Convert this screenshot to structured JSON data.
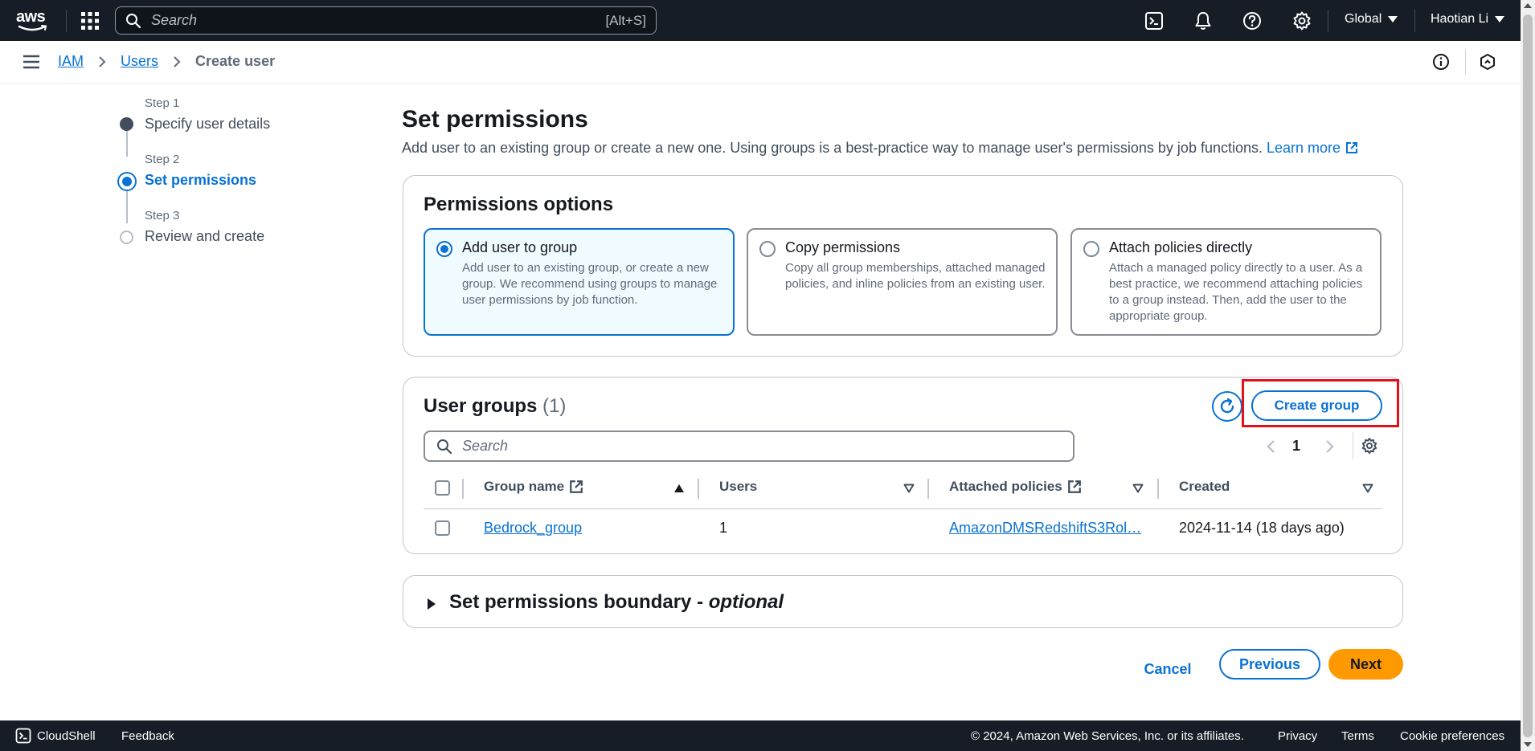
{
  "topbar": {
    "logo_text": "aws",
    "search_placeholder": "Search",
    "search_shortcut": "[Alt+S]",
    "region": "Global",
    "user": "Haotian Li"
  },
  "breadcrumb": {
    "items": [
      "IAM",
      "Users"
    ],
    "current": "Create user"
  },
  "steps": [
    {
      "num": "Step 1",
      "title": "Specify user details",
      "state": "completed"
    },
    {
      "num": "Step 2",
      "title": "Set permissions",
      "state": "active"
    },
    {
      "num": "Step 3",
      "title": "Review and create",
      "state": "pending"
    }
  ],
  "page": {
    "title": "Set permissions",
    "description": "Add user to an existing group or create a new one. Using groups is a best-practice way to manage user's permissions by job functions.",
    "learn_more": "Learn more"
  },
  "permissions_options": {
    "title": "Permissions options",
    "options": [
      {
        "title": "Add user to group",
        "desc": "Add user to an existing group, or create a new group. We recommend using groups to manage user permissions by job function.",
        "selected": true
      },
      {
        "title": "Copy permissions",
        "desc": "Copy all group memberships, attached managed policies, and inline policies from an existing user.",
        "selected": false
      },
      {
        "title": "Attach policies directly",
        "desc": "Attach a managed policy directly to a user. As a best practice, we recommend attaching policies to a group instead. Then, add the user to the appropriate group.",
        "selected": false
      }
    ]
  },
  "user_groups": {
    "title": "User groups",
    "count": "(1)",
    "create_button": "Create group",
    "search_placeholder": "Search",
    "page": "1",
    "columns": [
      "Group name",
      "Users",
      "Attached policies",
      "Created"
    ],
    "rows": [
      {
        "group_name": "Bedrock_group",
        "users": "1",
        "attached_policies": "AmazonDMSRedshiftS3Rol…",
        "created": "2024-11-14 (18 days ago)"
      }
    ]
  },
  "boundary": {
    "title": "Set permissions boundary - ",
    "optional": "optional"
  },
  "actions": {
    "cancel": "Cancel",
    "previous": "Previous",
    "next": "Next"
  },
  "footer": {
    "cloudshell": "CloudShell",
    "feedback": "Feedback",
    "copyright": "© 2024, Amazon Web Services, Inc. or its affiliates.",
    "privacy": "Privacy",
    "terms": "Terms",
    "cookie": "Cookie preferences"
  },
  "colors": {
    "nav_bg": "#161d26",
    "link_blue": "#0972d3",
    "primary_orange": "#ff9900",
    "highlight_red": "#e0111d",
    "selected_bg": "#f0fbff"
  }
}
